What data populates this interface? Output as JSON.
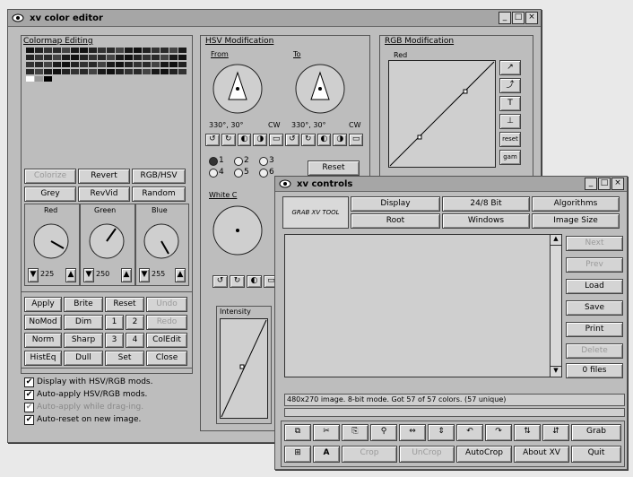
{
  "editor": {
    "title": "xv color editor",
    "colormap_label": "Colormap Editing",
    "buttons_row1": [
      "Colorize",
      "Revert",
      "RGB/HSV"
    ],
    "buttons_row2": [
      "Grey",
      "RevVid",
      "Random"
    ],
    "channels": [
      "Red",
      "Green",
      "Blue"
    ],
    "chan_values": [
      "225",
      "250",
      "255"
    ],
    "bottom_buttons": [
      [
        "Apply",
        "Brite",
        "Reset",
        "Undo"
      ],
      [
        "NoMod",
        "Dim",
        "1",
        "2",
        "Redo"
      ],
      [
        "Norm",
        "Sharp",
        "3",
        "4",
        "ColEdit"
      ],
      [
        "HistEq",
        "Dull",
        "Set",
        "Close"
      ]
    ],
    "checkboxes": [
      "Display with HSV/RGB mods.",
      "Auto-apply HSV/RGB mods.",
      "Auto-apply while drag-ing.",
      "Auto-reset on new image."
    ],
    "hsv_label": "HSV Modification",
    "from_label": "From",
    "to_label": "To",
    "from_values": "330°, 30°",
    "to_values": "330°, 30°",
    "dir_labels": [
      "CW",
      "CW"
    ],
    "radio_labels": [
      "1",
      "2",
      "3",
      "4",
      "5",
      "6"
    ],
    "reset_label": "Reset",
    "white_label": "White C",
    "values_by_label": "Intensity",
    "rgb_label": "RGB Modification",
    "red_curve_label": "Red",
    "curve_buttons": [
      "reset",
      "gam"
    ]
  },
  "controls": {
    "title": "xv controls",
    "logo": "GRAB XV TOOL",
    "menu_buttons": [
      "Display",
      "24/8 Bit",
      "Algorithms",
      "Root",
      "Windows",
      "Image Size"
    ],
    "side_buttons": [
      "Next",
      "Prev",
      "Load",
      "Save",
      "Print",
      "Delete",
      "0 files"
    ],
    "status": "480x270 image.  8-bit mode.  Got 57 of 57 colors.  (57 unique)",
    "bottom_row2": [
      "Crop",
      "UnCrop",
      "AutoCrop",
      "About XV",
      "Quit"
    ],
    "grab_label": "Grab",
    "text_tool": "A"
  },
  "colors": {
    "window_bg": "#bdbdbd",
    "button_bg": "#d4d4d4",
    "desktop": "#e9e9e9"
  }
}
